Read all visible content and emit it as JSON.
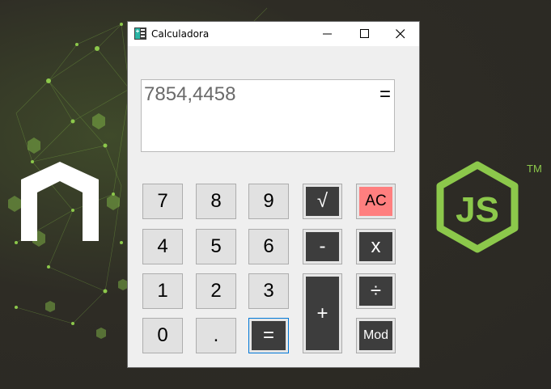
{
  "window": {
    "title": "Calculadora"
  },
  "display": {
    "value": "7854,4458",
    "operator": "="
  },
  "keypad": {
    "digits": [
      "7",
      "8",
      "9",
      "4",
      "5",
      "6",
      "1",
      "2",
      "3",
      "0",
      "."
    ],
    "sqrt": "√",
    "clear": "AC",
    "minus": "-",
    "multiply": "x",
    "plus": "+",
    "divide": "÷",
    "equals": "=",
    "modulo": "Mod"
  },
  "background": {
    "logo_text": "JS",
    "trademark": "TM"
  },
  "colors": {
    "node_green": "#8cc84b",
    "clear_button": "#ff7f7f",
    "operator_button": "#3d3d3d",
    "focus_border": "#0078d7"
  }
}
